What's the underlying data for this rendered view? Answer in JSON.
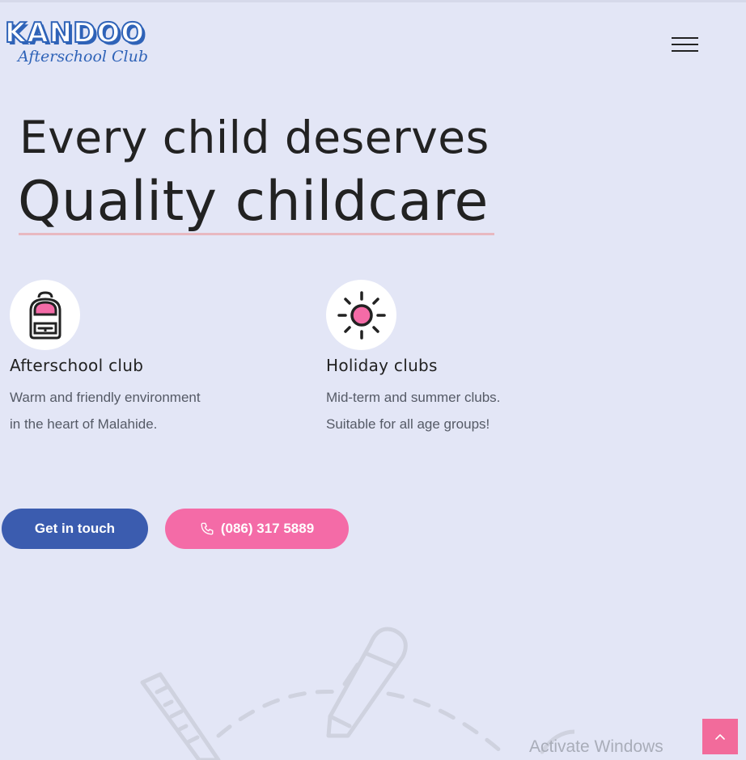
{
  "brand": {
    "logo_main": "KANDOO",
    "logo_sub": "Afterschool Club",
    "primary_color": "#3b5caf",
    "accent_color": "#f46ba7"
  },
  "header": {
    "menu_icon": "hamburger-menu-icon"
  },
  "hero": {
    "line1": "Every child deserves",
    "line2": "Quality childcare"
  },
  "features": [
    {
      "icon": "backpack-icon",
      "title": "Afterschool club",
      "description": "Warm and friendly environment in the heart of Malahide."
    },
    {
      "icon": "sun-icon",
      "title": "Holiday clubs",
      "description": "Mid-term and summer clubs. Suitable for all age groups!"
    }
  ],
  "cta": {
    "primary_label": "Get in touch",
    "phone_label": "(086) 317 5889",
    "phone_icon": "phone-icon"
  },
  "overlay": {
    "windows_watermark": "Activate Windows"
  },
  "scroll_top": {
    "icon": "chevron-up-icon"
  }
}
